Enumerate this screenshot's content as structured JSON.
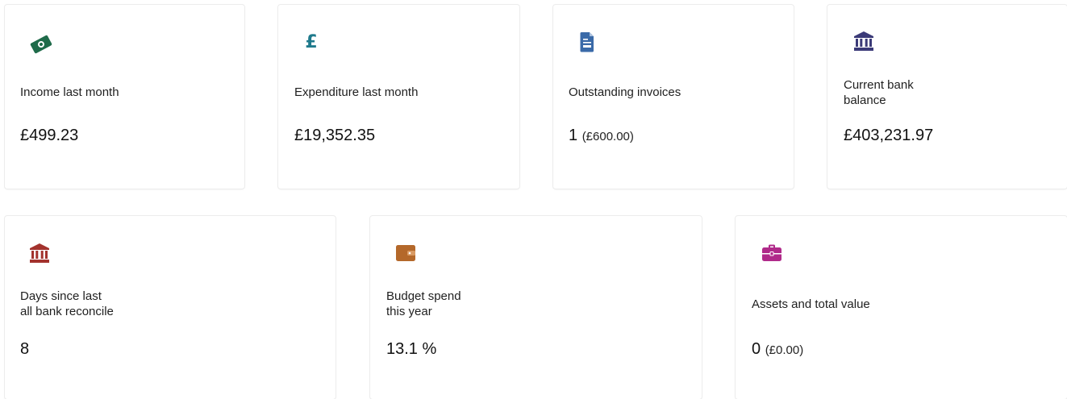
{
  "cards": [
    {
      "label": "Income last month",
      "value": "£499.23",
      "sub": "",
      "icon": "money-bill-icon",
      "color": "#1f6b4a"
    },
    {
      "label": "Expenditure last month",
      "value": "£19,352.35",
      "sub": "",
      "icon": "pound-sign-icon",
      "color": "#1f7a8c"
    },
    {
      "label": "Outstanding invoices",
      "value": "1",
      "sub": "(£600.00)",
      "icon": "invoice-icon",
      "color": "#3a6aa8"
    },
    {
      "label": "Current bank\nbalance",
      "value": "£403,231.97",
      "sub": "",
      "icon": "bank-icon",
      "color": "#3b3a78"
    },
    {
      "label": "Days since last\nall bank reconcile",
      "value": "8",
      "sub": "",
      "icon": "bank-icon",
      "color": "#a3322d"
    },
    {
      "label": "Budget spend\nthis year",
      "value": "13.1 %",
      "sub": "",
      "icon": "wallet-icon",
      "color": "#b4682a"
    },
    {
      "label": "Assets and total value",
      "value": "0",
      "sub": "(£0.00)",
      "icon": "briefcase-icon",
      "color": "#b02a8a"
    }
  ]
}
